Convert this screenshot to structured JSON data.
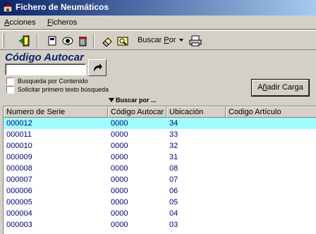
{
  "window": {
    "title": "Fichero de Neumáticos"
  },
  "menu": [
    {
      "label": "Acciones"
    },
    {
      "label": "Ficheros"
    }
  ],
  "toolbar": {
    "buttons": [
      "exit-icon",
      "new-record-icon",
      "view-icon",
      "delete-icon",
      "eraser-icon",
      "search-icon"
    ],
    "buscar_por_label": "Buscar Por",
    "print_icon": "print-icon"
  },
  "search": {
    "title": "Código Autocar",
    "value": "",
    "placeholder": "",
    "go_icon": "arrow-right-icon",
    "options": [
      {
        "label": "Busqueda por Contenido",
        "checked": false
      },
      {
        "label": "Solicitar primero texto búsqueda",
        "checked": false
      }
    ],
    "buscar_por_link": "Buscar por ..."
  },
  "add_button": {
    "label": "Añadir Carga"
  },
  "colors": {
    "selected_row": "#9ffcff",
    "row_text": "#000080",
    "title_accent": "#0a246a"
  },
  "grid": {
    "columns": [
      "Numero de Serie",
      "Código Autocar",
      "Ubicación",
      "Codigo Artículo"
    ],
    "rows": [
      {
        "serie": "000012",
        "autocar": "0000",
        "ubicacion": "34",
        "articulo": "",
        "selected": true
      },
      {
        "serie": "000011",
        "autocar": "0000",
        "ubicacion": "33",
        "articulo": ""
      },
      {
        "serie": "000010",
        "autocar": "0000",
        "ubicacion": "32",
        "articulo": ""
      },
      {
        "serie": "000009",
        "autocar": "0000",
        "ubicacion": "31",
        "articulo": ""
      },
      {
        "serie": "000008",
        "autocar": "0000",
        "ubicacion": "08",
        "articulo": ""
      },
      {
        "serie": "000007",
        "autocar": "0000",
        "ubicacion": "07",
        "articulo": ""
      },
      {
        "serie": "000006",
        "autocar": "0000",
        "ubicacion": "06",
        "articulo": ""
      },
      {
        "serie": "000005",
        "autocar": "0000",
        "ubicacion": "05",
        "articulo": ""
      },
      {
        "serie": "000004",
        "autocar": "0000",
        "ubicacion": "04",
        "articulo": ""
      },
      {
        "serie": "000003",
        "autocar": "0000",
        "ubicacion": "03",
        "articulo": ""
      }
    ]
  }
}
